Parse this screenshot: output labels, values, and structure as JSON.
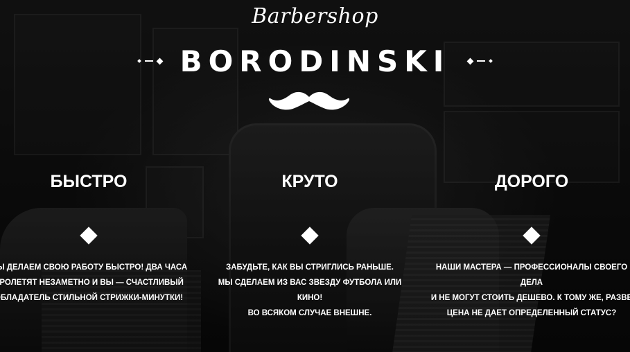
{
  "brand": {
    "script": "Barbershop",
    "name": "BORODINSKI"
  },
  "features": [
    {
      "title": "БЫСТРО",
      "text": "МЫ ДЕЛАЕМ СВОЮ РАБОТУ БЫСТРО! ДВА ЧАСА\nПРОЛЕТЯТ НЕЗАМЕТНО И ВЫ — СЧАСТЛИВЫЙ\nОБЛАДАТЕЛЬ СТИЛЬНОЙ СТРИЖКИ-МИНУТКИ!"
    },
    {
      "title": "КРУТО",
      "text": "ЗАБУДЬТЕ, КАК ВЫ СТРИГЛИСЬ РАНЬШЕ.\nМЫ СДЕЛАЕМ ИЗ ВАС ЗВЕЗДУ ФУТБОЛА ИЛИ КИНО!\nВО ВСЯКОМ СЛУЧАЕ ВНЕШНЕ."
    },
    {
      "title": "ДОРОГО",
      "text": "НАШИ МАСТЕРА — ПРОФЕССИОНАЛЫ СВОЕГО ДЕЛА\nИ НЕ МОГУТ СТОИТЬ ДЕШЕВО. К ТОМУ ЖЕ, РАЗВЕ\nЦЕНА НЕ ДАЕТ ОПРЕДЕЛЕННЫЙ СТАТУС?"
    }
  ],
  "icons": {
    "mustache": "mustache-icon",
    "diamond": "diamond-icon"
  },
  "colors": {
    "text": "#ffffff",
    "background": "#0d0d0d"
  }
}
